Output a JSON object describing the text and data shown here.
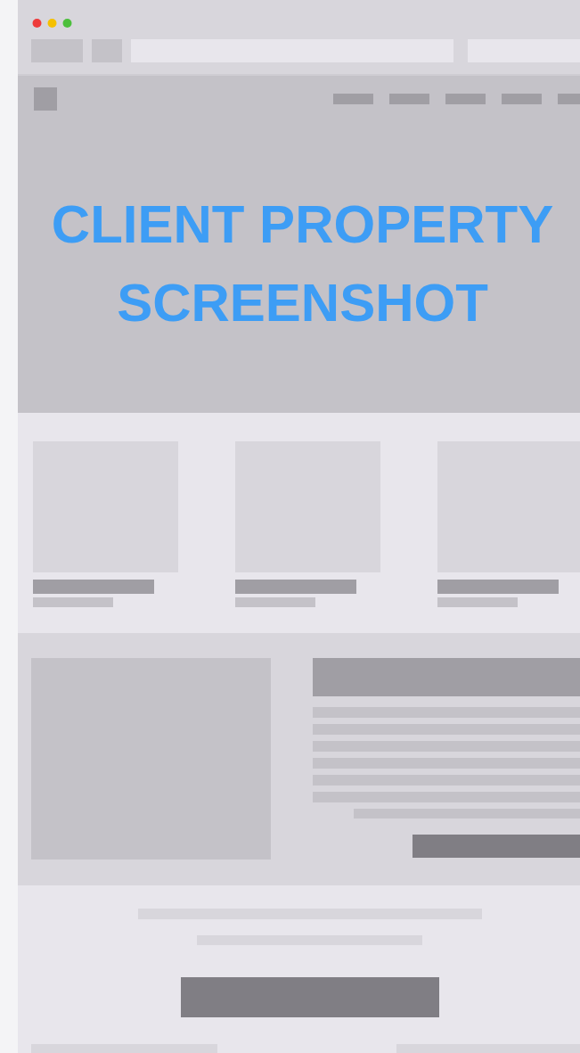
{
  "hero": {
    "title_lines": [
      "CLIENT PROPERTY",
      "SCREENSHOT"
    ]
  }
}
